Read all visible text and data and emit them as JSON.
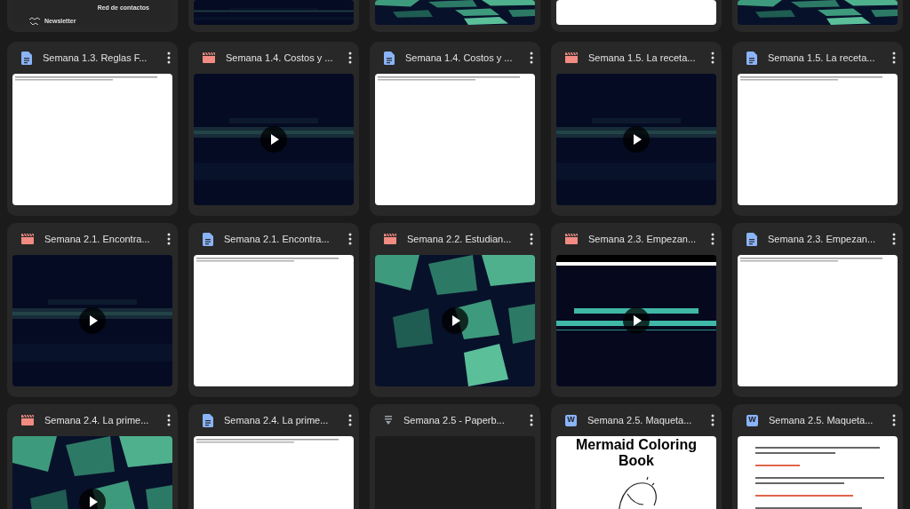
{
  "top_row": [
    {
      "thumb": {
        "kind": "newsletter",
        "texts": [
          "Red de contactos",
          "Newsletter"
        ]
      }
    },
    {
      "thumb": {
        "kind": "video-dark"
      }
    },
    {
      "thumb": {
        "kind": "video-green"
      }
    },
    {
      "thumb": {
        "kind": "doc-white"
      }
    },
    {
      "thumb": {
        "kind": "video-green"
      }
    }
  ],
  "files": [
    {
      "kind": "doc",
      "title": "Semana 1.3. Reglas F...",
      "thumb": {
        "kind": "doc-white"
      }
    },
    {
      "kind": "video",
      "title": "Semana 1.4. Costos y ...",
      "thumb": {
        "kind": "video-dark"
      }
    },
    {
      "kind": "doc",
      "title": "Semana 1.4. Costos y ...",
      "thumb": {
        "kind": "doc-white"
      }
    },
    {
      "kind": "video",
      "title": "Semana 1.5. La receta...",
      "thumb": {
        "kind": "video-dark"
      }
    },
    {
      "kind": "doc",
      "title": "Semana 1.5. La receta...",
      "thumb": {
        "kind": "doc-white"
      }
    },
    {
      "kind": "video",
      "title": "Semana 2.1. Encontra...",
      "thumb": {
        "kind": "video-dark"
      }
    },
    {
      "kind": "doc",
      "title": "Semana 2.1. Encontra...",
      "thumb": {
        "kind": "doc-white"
      }
    },
    {
      "kind": "video",
      "title": "Semana 2.2. Estudian...",
      "thumb": {
        "kind": "video-green"
      }
    },
    {
      "kind": "video",
      "title": "Semana 2.3. Empezan...",
      "thumb": {
        "kind": "video-banner"
      }
    },
    {
      "kind": "doc",
      "title": "Semana 2.3. Empezan...",
      "thumb": {
        "kind": "doc-white"
      }
    },
    {
      "kind": "video",
      "title": "Semana 2.4. La prime...",
      "thumb": {
        "kind": "video-green"
      }
    },
    {
      "kind": "doc",
      "title": "Semana 2.4. La prime...",
      "thumb": {
        "kind": "doc-white"
      }
    },
    {
      "kind": "file",
      "title": "Semana 2.5 - Paperb...",
      "thumb": {
        "kind": "blank-dark"
      }
    },
    {
      "kind": "word",
      "badge": "W",
      "title": "Semana 2.5. Maqueta...",
      "thumb": {
        "kind": "word-cover",
        "cover_title": "Mermaid Coloring Book"
      }
    },
    {
      "kind": "word",
      "badge": "W",
      "title": "Semana 2.5. Maqueta...",
      "thumb": {
        "kind": "word-text"
      }
    }
  ]
}
